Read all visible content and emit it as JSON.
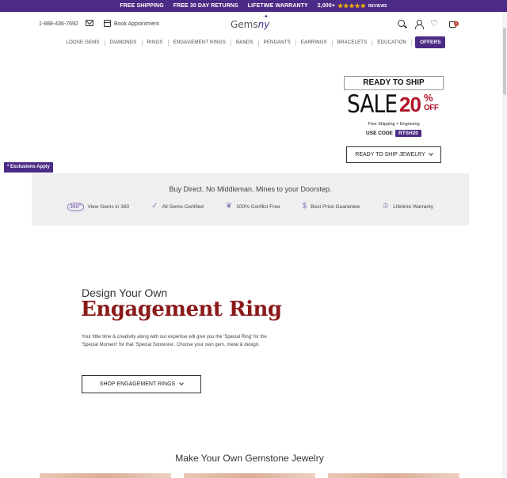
{
  "promo": {
    "items": [
      "FREE SHIPPING",
      "FREE 30 DAY RETURNS",
      "LIFETIME WARRANTY"
    ],
    "review_count": "2,000+",
    "stars": "★★★★★",
    "reviews_label": "REVIEWS"
  },
  "header": {
    "phone": "1-888-436-7692",
    "book_appointment": "Book Appointment",
    "logo_main": "Gems",
    "logo_accent": "ny",
    "cart_count": "0"
  },
  "nav": {
    "items": [
      "LOOSE GEMS",
      "DIAMONDS",
      "RINGS",
      "ENGAGEMENT RINGS",
      "BANDS",
      "PENDANTS",
      "EARRINGS",
      "BRACELETS",
      "EDUCATION"
    ],
    "offers": "OFFERS"
  },
  "hero": {
    "ready_title": "READY TO SHIP",
    "sale_word": "SALE",
    "sale_number": "20",
    "sale_sign": "%",
    "sale_off": "OFF",
    "subtext": "Free Shipping + Engraving",
    "use_code_label": "USE CODE",
    "code": "RTSH20",
    "button_label": "READY TO SHIP JEWELRY",
    "exclusions": "* Exclusions Apply"
  },
  "trust": {
    "headline": "Buy Direct. No Middleman. Mines to your Doorstep.",
    "items": [
      {
        "icon": "360-icon",
        "glyph": "360°",
        "label": "View Gems in 360"
      },
      {
        "icon": "certified-icon",
        "glyph": "✓",
        "label": "All Gems Certified"
      },
      {
        "icon": "leaf-icon",
        "glyph": "❦",
        "label": "100% Conflict Free"
      },
      {
        "icon": "price-tag-icon",
        "glyph": "$",
        "label": "Best Price Guarantee"
      },
      {
        "icon": "warranty-icon",
        "glyph": "♔",
        "label": "Lifetime Warranty"
      }
    ]
  },
  "design": {
    "pre_title": "Design Your Own",
    "title": "Engagement Ring",
    "body": "Your little time & creativity along with our expertise will give you the 'Special Ring' for the 'Special Moment' for that 'Special Someone'. Choose your own gem, metal & design.",
    "button_label": "SHOP ENGAGEMENT RINGS"
  },
  "gemstone_section": {
    "title": "Make Your Own Gemstone Jewelry"
  },
  "colors": {
    "brand_purple": "#4b2b85",
    "sale_red": "#b0142b",
    "title_red": "#8b1a1a"
  }
}
